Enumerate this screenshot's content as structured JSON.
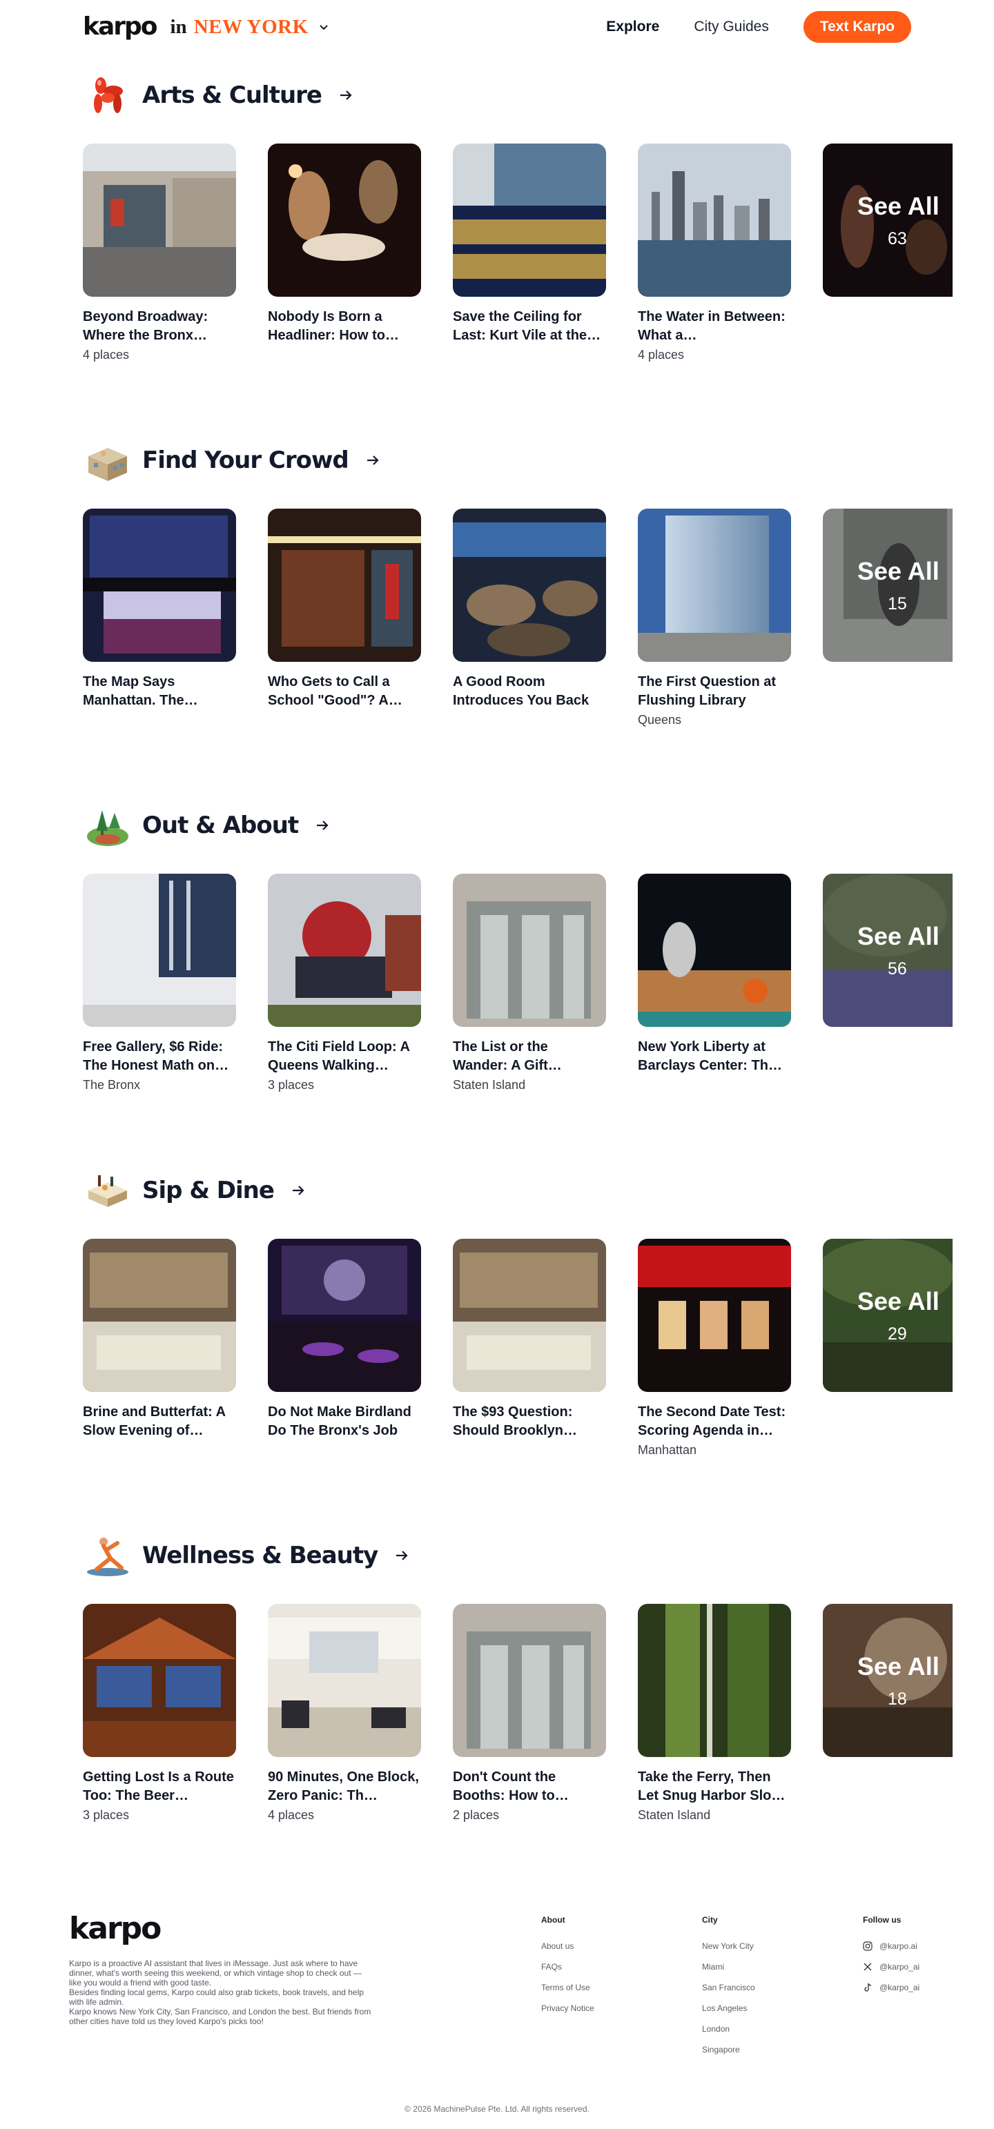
{
  "header": {
    "logo": "karpo",
    "city_prefix": "in",
    "city": "NEW YORK",
    "nav": [
      {
        "label": "Explore"
      },
      {
        "label": "City Guides"
      }
    ],
    "cta": "Text Karpo"
  },
  "sections": [
    {
      "title": "Arts & Culture",
      "icon": "balloon-dog-icon",
      "cards": [
        {
          "title": "Beyond Broadway: Where the Bronx…",
          "meta": "4 places"
        },
        {
          "title": "Nobody Is Born a Headliner: How to…",
          "meta": ""
        },
        {
          "title": "Save the Ceiling for Last: Kurt Vile at the…",
          "meta": ""
        },
        {
          "title": "The Water in Between: What a…",
          "meta": "4 places"
        }
      ],
      "see_all": {
        "label": "See All",
        "count": "63"
      }
    },
    {
      "title": "Find Your Crowd",
      "icon": "community-building-icon",
      "cards": [
        {
          "title": "The Map Says Manhattan. The…",
          "meta": ""
        },
        {
          "title": "Who Gets to Call a School \"Good\"? A…",
          "meta": ""
        },
        {
          "title": "A Good Room Introduces You Back",
          "meta": ""
        },
        {
          "title": "The First Question at Flushing Library",
          "meta": "Queens"
        }
      ],
      "see_all": {
        "label": "See All",
        "count": "15"
      }
    },
    {
      "title": "Out & About",
      "icon": "park-trees-icon",
      "cards": [
        {
          "title": "Free Gallery, $6 Ride: The Honest Math on…",
          "meta": "The Bronx"
        },
        {
          "title": "The Citi Field Loop: A Queens Walking…",
          "meta": "3 places"
        },
        {
          "title": "The List or the Wander: A Gift…",
          "meta": "Staten Island"
        },
        {
          "title": "New York Liberty at Barclays Center: Th…",
          "meta": ""
        }
      ],
      "see_all": {
        "label": "See All",
        "count": "56"
      }
    },
    {
      "title": "Sip & Dine",
      "icon": "dining-table-icon",
      "cards": [
        {
          "title": "Brine and Butterfat: A Slow Evening of…",
          "meta": ""
        },
        {
          "title": "Do Not Make Birdland Do The Bronx's Job",
          "meta": ""
        },
        {
          "title": "The $93 Question: Should Brooklyn…",
          "meta": ""
        },
        {
          "title": "The Second Date Test: Scoring Agenda in…",
          "meta": "Manhattan"
        }
      ],
      "see_all": {
        "label": "See All",
        "count": "29"
      }
    },
    {
      "title": "Wellness & Beauty",
      "icon": "yoga-pose-icon",
      "cards": [
        {
          "title": "Getting Lost Is a Route Too: The Beer…",
          "meta": "3 places"
        },
        {
          "title": "90 Minutes, One Block, Zero Panic: Th…",
          "meta": "4 places"
        },
        {
          "title": "Don't Count the Booths: How to…",
          "meta": "2 places"
        },
        {
          "title": "Take the Ferry, Then Let Snug Harbor Slo…",
          "meta": "Staten Island"
        }
      ],
      "see_all": {
        "label": "See All",
        "count": "18"
      }
    }
  ],
  "footer": {
    "logo": "karpo",
    "about_text_1": "Karpo is a proactive AI assistant that lives in iMessage. Just ask where to have dinner, what's worth seeing this weekend, or which vintage shop to check out — like you would a friend with good taste.",
    "about_text_2": "Besides finding local gems, Karpo could also grab tickets, book travels, and help with life admin.",
    "about_text_3": "Karpo knows New York City, San Francisco, and London the best. But friends from other cities have told us they loved Karpo's picks too!",
    "about_head": "About",
    "about_links": [
      "About us",
      "FAQs",
      "Terms of Use",
      "Privacy Notice"
    ],
    "city_head": "City",
    "city_links": [
      "New York City",
      "Miami",
      "San Francisco",
      "Los Angeles",
      "London",
      "Singapore"
    ],
    "follow_head": "Follow us",
    "socials": [
      {
        "icon": "instagram-icon",
        "handle": "@karpo.ai"
      },
      {
        "icon": "x-icon",
        "handle": "@karpo_ai"
      },
      {
        "icon": "tiktok-icon",
        "handle": "@karpo_ai"
      }
    ],
    "copyright": "© 2026 MachinePulse Pte. Ltd. All rights reserved."
  }
}
